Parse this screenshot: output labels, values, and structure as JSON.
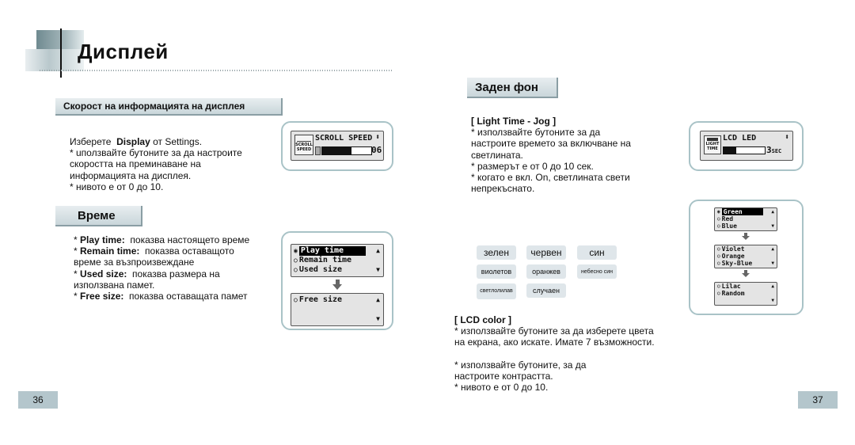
{
  "page": {
    "title": "Дисплей",
    "page_left": "36",
    "page_right": "37"
  },
  "scroll": {
    "header": "Скорост на информацията на дисплея",
    "intro_prefix": "Изберете",
    "intro_bold": "Display",
    "intro_suffix": "от Settings.",
    "lines": [
      "* uползвайте бутоните за да настроите",
      "скоростта на преминаване на",
      "информацията на дисплея.",
      "* нивото е  от 0 до 10."
    ],
    "lcd": {
      "icon_text_1": "SCROLL",
      "icon_text_2": "SPEED",
      "label": "SCROLL SPEED",
      "value": "06",
      "level_fraction": 0.6
    }
  },
  "time": {
    "header": "Време",
    "items": [
      {
        "term": "Play time:",
        "desc": "показва настоящето време"
      },
      {
        "term": "Remain time:",
        "desc": "показва оставащото",
        "cont": "време за възпроизвеждане"
      },
      {
        "term": "Used size:",
        "desc": "показва размера на",
        "cont": "използвана памет."
      },
      {
        "term": "Free size:",
        "desc": "показва оставащата памет"
      }
    ],
    "lcd_screen1": [
      "Play time",
      "Remain time",
      "Used size"
    ],
    "lcd_screen2": [
      "Free size"
    ]
  },
  "background": {
    "header": "Заден фон",
    "light_title": "[ Light Time - Jog ]",
    "light_lines": [
      "* използвайте бутоните за да",
      "настроите времето за включване на",
      "светлината.",
      "* размерът е от 0 до 10 сек.",
      "* когато е вкл. On, светлината свети",
      "непрекъснато."
    ],
    "lcd": {
      "icon_text_1": "LIGHT",
      "icon_text_2": "TIME",
      "label": "LCD LED",
      "value": "3",
      "unit": "SEC",
      "level_fraction": 0.3
    },
    "color_chips": [
      [
        "зелен",
        "червен",
        "син"
      ],
      [
        "виолетов",
        "оранжев",
        "небесно син"
      ],
      [
        "светлолилав",
        "случаен"
      ]
    ],
    "color_screens": [
      [
        "Green",
        "Red",
        "Blue"
      ],
      [
        "Violet",
        "Orange",
        "Sky-Blue"
      ],
      [
        "Lilac",
        "Random"
      ]
    ],
    "lcd_color_title": "[ LCD color ]",
    "lcd_color_lines": [
      "* използвайте бутоните за да изберете цвета",
      "на екрана, ако искате. Имате 7 възможности."
    ],
    "contrast_lines": [
      "* използвайте бутоните, за да",
      "настроите  контрастта.",
      "* нивото е от 0 до 10."
    ]
  },
  "colors": {
    "accent": "#b4c6cc",
    "frame": "#a9c3c7",
    "chip": "#dfe6ea"
  }
}
